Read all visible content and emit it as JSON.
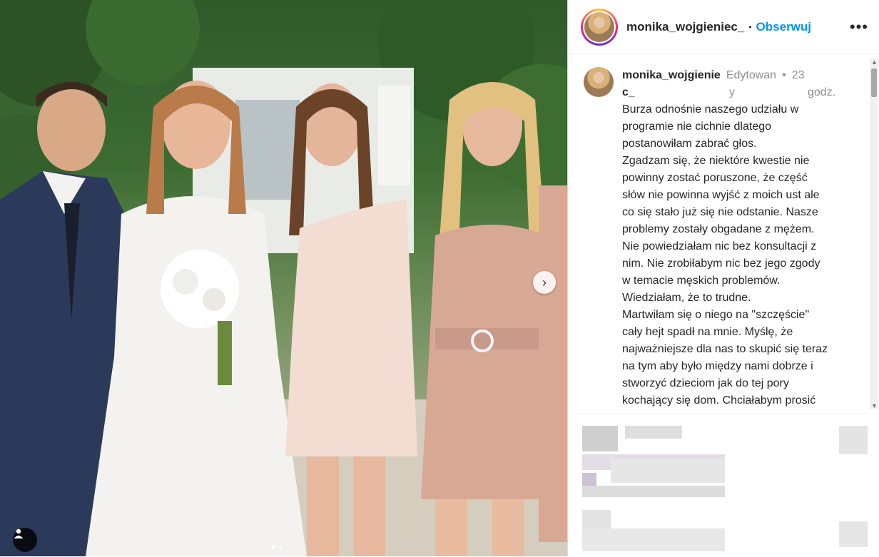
{
  "post": {
    "username": "monika_wojgieniec_",
    "follow_label": "Obserwuj",
    "bullet": "•",
    "more_label": "•••"
  },
  "caption": {
    "username_line1": "monika_wojgienie",
    "username_line2": "c_",
    "edited_line1": "Edytowan",
    "edited_line2": "y",
    "time_line1": "23",
    "time_line2": "godz.",
    "bullet": "•",
    "text": "Burza odnośnie naszego udziału w\nprogramie nie cichnie dlatego\npostanowiłam zabrać głos.\nZgadzam się, że niektóre kwestie nie\npowinny zostać poruszone, że część\nsłów nie powinna wyjść z moich ust ale\nco się stało już się nie odstanie. Nasze\nproblemy zostały obgadane z mężem.\nNie powiedziałam nic bez konsultacji z\nnim. Nie zrobiłabym nic bez jego zgody\nw temacie męskich problemów.\nWiedziałam, że to trudne.\nMartwiłam się o niego na \"szczęście\"\ncały hejt spadł na mnie. Myślę, że\nnajważniejsze dla nas to skupić się teraz\nna tym aby było między nami dobrze i\nstworzyć dzieciom jak do tej pory\nkochający się dom. Chciałabym prosić"
  },
  "icons": {
    "next": "chevron-right-icon",
    "tag": "user-tag-icon"
  },
  "carousel": {
    "total_slides": 2,
    "active_slide": 1
  }
}
